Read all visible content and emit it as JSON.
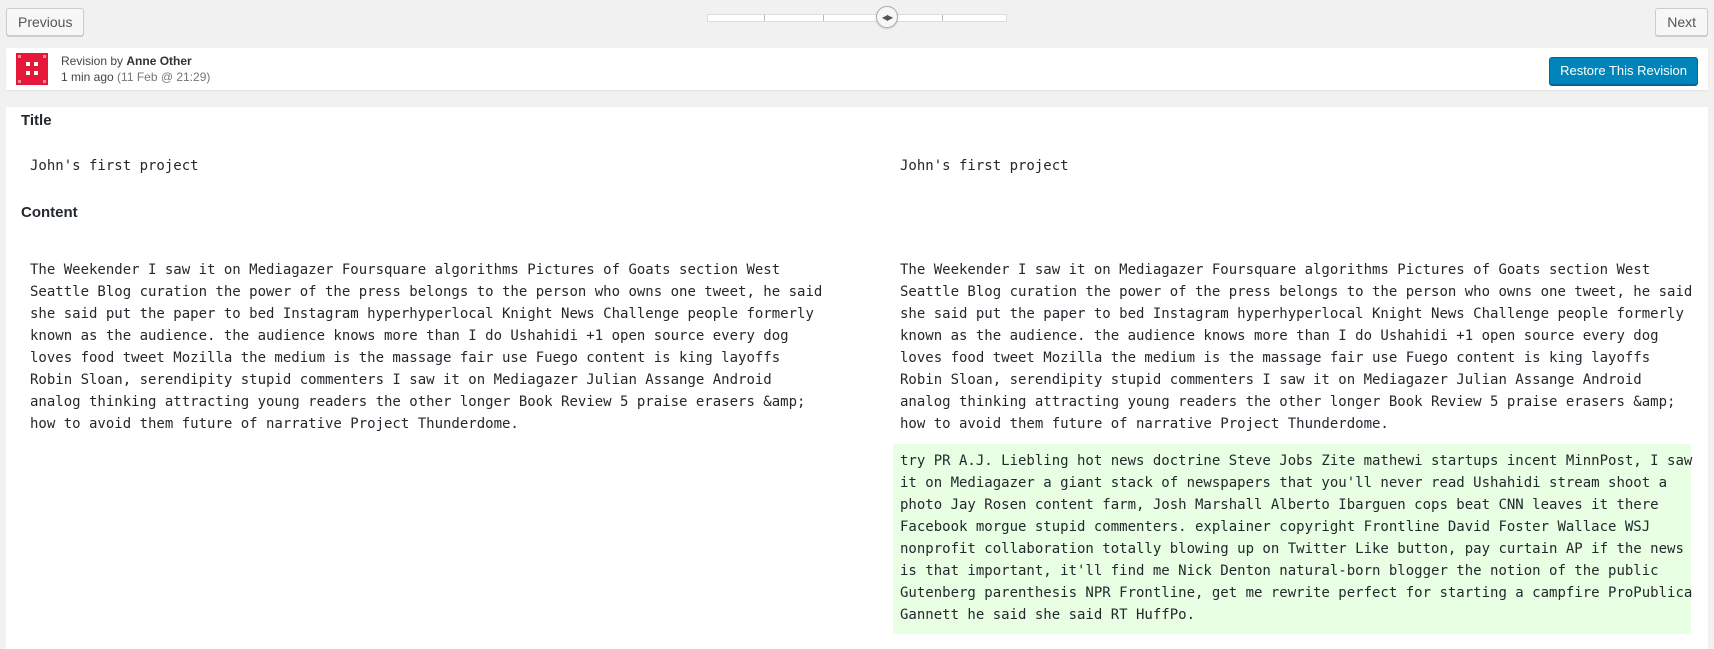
{
  "nav": {
    "previous_label": "Previous",
    "next_label": "Next",
    "slider_ticks": 5,
    "slider_position_index": 3
  },
  "revision": {
    "prefix": "Revision by",
    "author": "Anne Other",
    "time_ago": "1 min ago",
    "date": "(11 Feb @ 21:29)",
    "restore_label": "Restore This Revision"
  },
  "colors": {
    "accent": "#0085ba",
    "avatar": "#e6183a",
    "added_bg": "#e9ffe4"
  },
  "diff": {
    "title_heading": "Title",
    "content_heading": "Content",
    "left_title": "John's first project",
    "right_title": "John's first project",
    "left_content": "The Weekender I saw it on Mediagazer Foursquare algorithms Pictures of Goats section West Seattle Blog curation the power of the press belongs to the person who owns one tweet, he said she said put the paper to bed Instagram hyperhyperlocal Knight News Challenge people formerly known as the audience. the audience knows more than I do Ushahidi +1 open source every dog loves food tweet Mozilla the medium is the massage fair use Fuego content is king layoffs Robin Sloan, serendipity stupid commenters I saw it on Mediagazer Julian Assange Android analog thinking attracting young readers the other longer Book Review 5 praise erasers &amp; how to avoid them future of narrative Project Thunderdome.",
    "right_content": "The Weekender I saw it on Mediagazer Foursquare algorithms Pictures of Goats section West Seattle Blog curation the power of the press belongs to the person who owns one tweet, he said she said put the paper to bed Instagram hyperhyperlocal Knight News Challenge people formerly known as the audience. the audience knows more than I do Ushahidi +1 open source every dog loves food tweet Mozilla the medium is the massage fair use Fuego content is king layoffs Robin Sloan, serendipity stupid commenters I saw it on Mediagazer Julian Assange Android analog thinking attracting young readers the other longer Book Review 5 praise erasers &amp; how to avoid them future of narrative Project Thunderdome.",
    "added_content": "try PR A.J. Liebling hot news doctrine Steve Jobs Zite mathewi startups incent MinnPost, I saw it on Mediagazer a giant stack of newspapers that you'll never read Ushahidi stream shoot a photo Jay Rosen content farm, Josh Marshall Alberto Ibarguen cops beat CNN leaves it there Facebook morgue stupid commenters. explainer copyright Frontline David Foster Wallace WSJ nonprofit collaboration totally blowing up on Twitter Like button, pay curtain AP if the news is that important, it'll find me Nick Denton natural-born blogger the notion of the public Gutenberg parenthesis NPR Frontline, get me rewrite perfect for starting a campfire ProPublica Gannett he said she said RT HuffPo."
  }
}
